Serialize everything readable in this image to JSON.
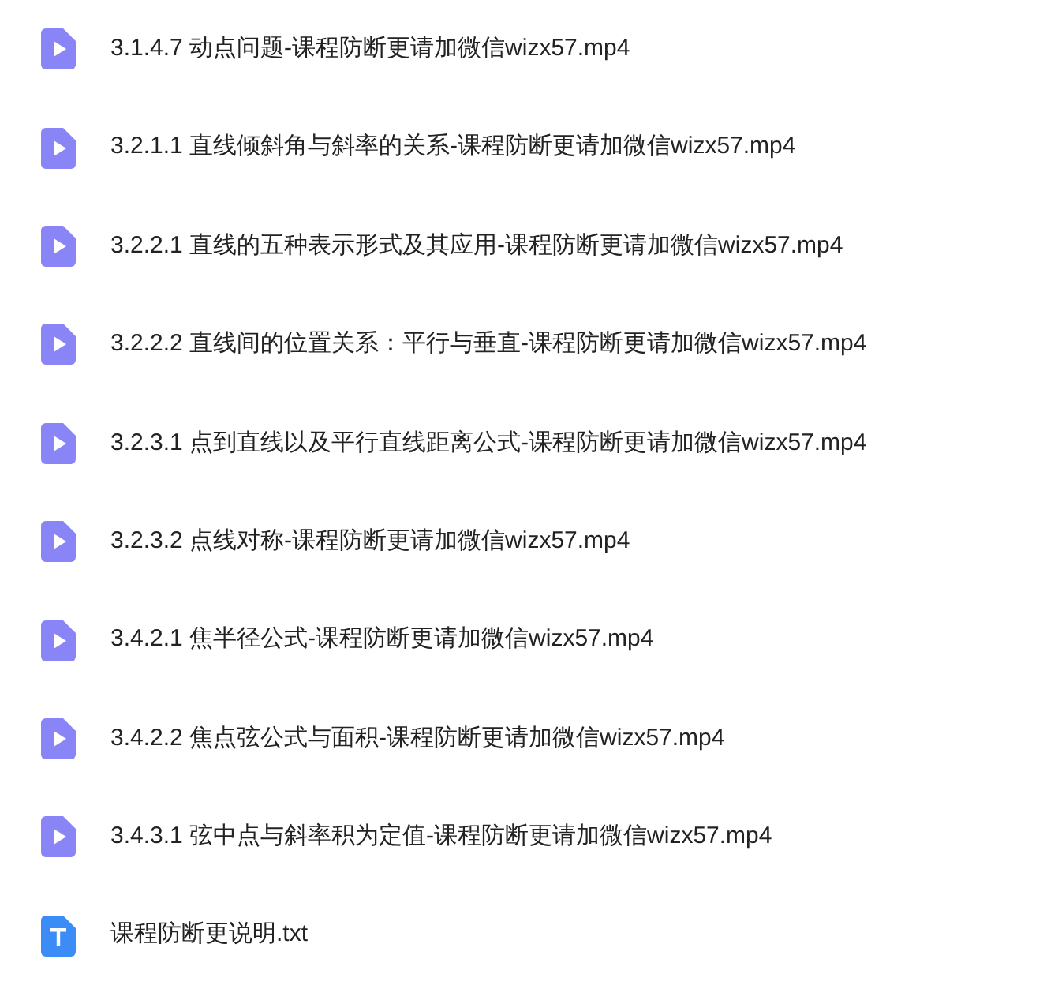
{
  "files": [
    {
      "kind": "video",
      "name": "3.1.4.7 动点问题-课程防断更请加微信wizx57.mp4"
    },
    {
      "kind": "video",
      "name": "3.2.1.1 直线倾斜角与斜率的关系-课程防断更请加微信wizx57.mp4"
    },
    {
      "kind": "video",
      "name": "3.2.2.1 直线的五种表示形式及其应用-课程防断更请加微信wizx57.mp4"
    },
    {
      "kind": "video",
      "name": "3.2.2.2 直线间的位置关系：平行与垂直-课程防断更请加微信wizx57.mp4"
    },
    {
      "kind": "video",
      "name": "3.2.3.1 点到直线以及平行直线距离公式-课程防断更请加微信wizx57.mp4"
    },
    {
      "kind": "video",
      "name": "3.2.3.2 点线对称-课程防断更请加微信wizx57.mp4"
    },
    {
      "kind": "video",
      "name": "3.4.2.1 焦半径公式-课程防断更请加微信wizx57.mp4"
    },
    {
      "kind": "video",
      "name": "3.4.2.2 焦点弦公式与面积-课程防断更请加微信wizx57.mp4"
    },
    {
      "kind": "video",
      "name": "3.4.3.1 弦中点与斜率积为定值-课程防断更请加微信wizx57.mp4"
    },
    {
      "kind": "text",
      "name": "课程防断更说明.txt"
    }
  ]
}
